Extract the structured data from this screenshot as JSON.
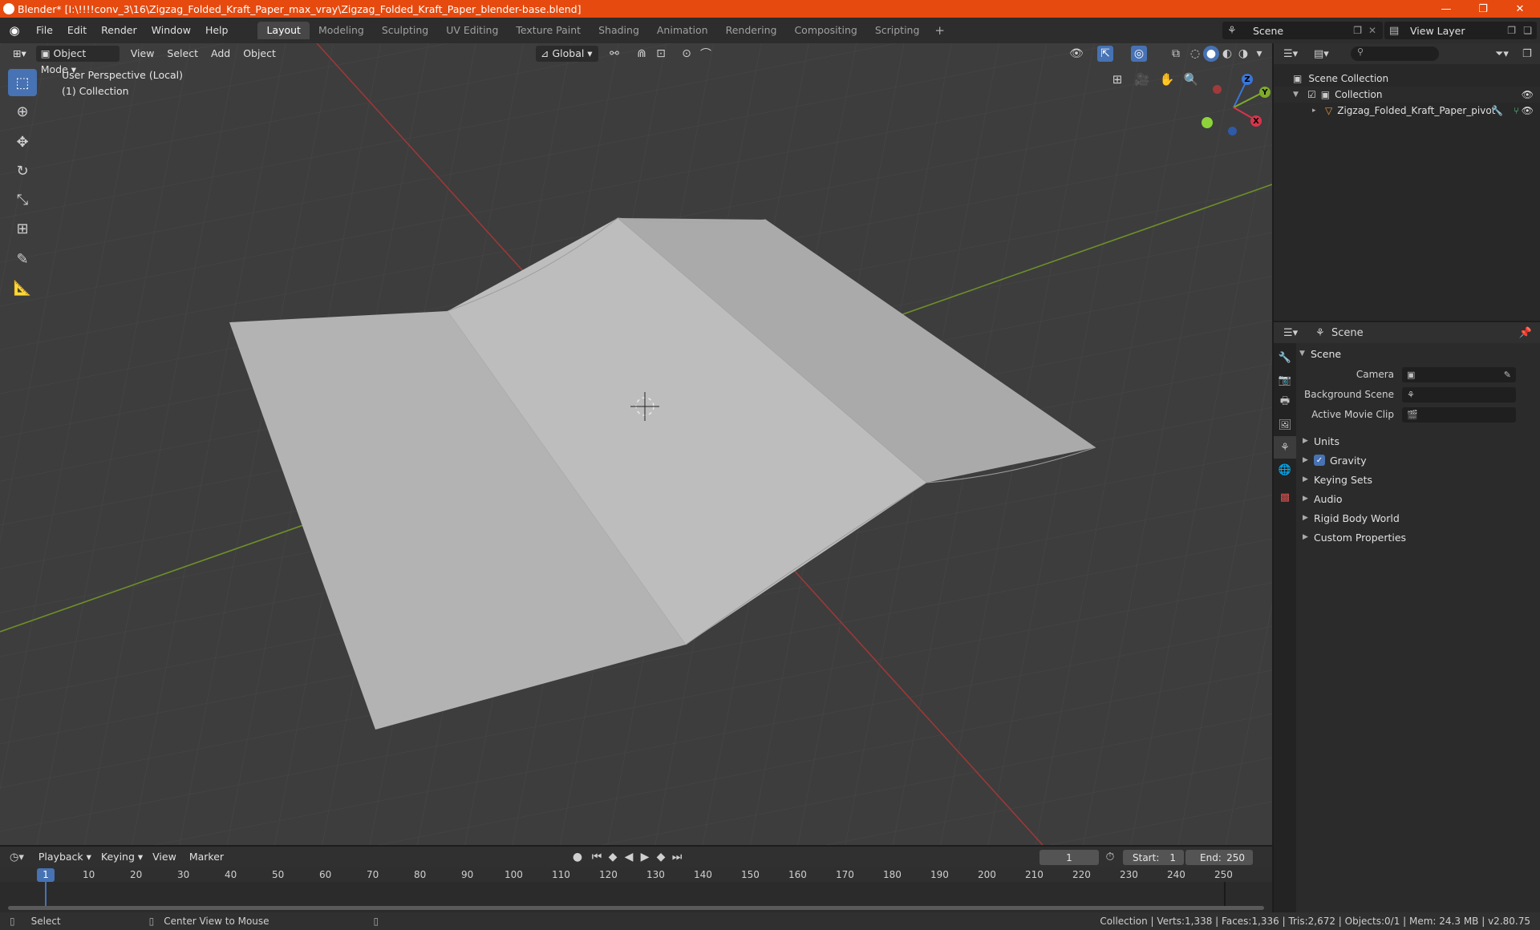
{
  "window": {
    "title": "Blender* [I:\\!!!!conv_3\\16\\Zigzag_Folded_Kraft_Paper_max_vray\\Zigzag_Folded_Kraft_Paper_blender-base.blend]",
    "minimize": "—",
    "maximize": "❐",
    "close": "✕"
  },
  "menu": {
    "items": [
      "File",
      "Edit",
      "Render",
      "Window",
      "Help"
    ]
  },
  "workspaces": {
    "tabs": [
      "Layout",
      "Modeling",
      "Sculpting",
      "UV Editing",
      "Texture Paint",
      "Shading",
      "Animation",
      "Rendering",
      "Compositing",
      "Scripting"
    ],
    "active": "Layout",
    "add": "+"
  },
  "scene_selector": {
    "value": "Scene"
  },
  "view_layer_selector": {
    "value": "View Layer"
  },
  "viewport": {
    "mode": "Object Mode",
    "menus": [
      "View",
      "Select",
      "Add",
      "Object"
    ],
    "orientation": "Global",
    "info_line1": "User Perspective (Local)",
    "info_line2": "(1) Collection",
    "gizmo": {
      "x": "X",
      "y": "Y",
      "z": "Z"
    }
  },
  "outliner": {
    "search_placeholder": "⚲",
    "scene_collection": "Scene Collection",
    "collection": "Collection",
    "object": "Zigzag_Folded_Kraft_Paper_pivot"
  },
  "properties": {
    "header_title": "Scene",
    "panel_title": "Scene",
    "camera_label": "Camera",
    "bg_scene_label": "Background Scene",
    "movie_clip_label": "Active Movie Clip",
    "subpanels": {
      "units": "Units",
      "gravity": "Gravity",
      "keying_sets": "Keying Sets",
      "audio": "Audio",
      "rigid_body": "Rigid Body World",
      "custom_props": "Custom Properties"
    },
    "gravity_checked": true
  },
  "timeline": {
    "menus": [
      "Playback",
      "Keying",
      "View",
      "Marker"
    ],
    "current_frame": "1",
    "start_label": "Start:",
    "start_value": "1",
    "end_label": "End:",
    "end_value": "250",
    "ruler": [
      "1",
      "10",
      "20",
      "30",
      "40",
      "50",
      "60",
      "70",
      "80",
      "90",
      "100",
      "110",
      "120",
      "130",
      "140",
      "150",
      "160",
      "170",
      "180",
      "190",
      "200",
      "210",
      "220",
      "230",
      "240",
      "250"
    ]
  },
  "statusbar": {
    "select": "Select",
    "center_view": "Center View to Mouse",
    "stats": "Collection | Verts:1,338 | Faces:1,336 | Tris:2,672 | Objects:0/1 | Mem: 24.3 MB | v2.80.75"
  },
  "colors": {
    "title_bar": "#e64a0f",
    "accent": "#4772b3",
    "x_axis": "#b03a3a",
    "y_axis": "#7a9a2a"
  }
}
